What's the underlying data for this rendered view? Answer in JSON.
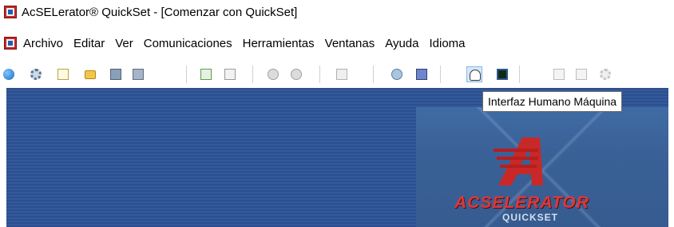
{
  "window": {
    "title": "AcSELerator® QuickSet - [Comenzar con QuickSet]"
  },
  "menubar": {
    "items": [
      "Archivo",
      "Editar",
      "Ver",
      "Comunicaciones",
      "Herramientas",
      "Ventanas",
      "Ayuda",
      "Idioma"
    ]
  },
  "toolbar": {
    "buttons": [
      {
        "icon": "globe-icon"
      },
      {
        "icon": "settings-gear-icon"
      },
      {
        "icon": "new-document-icon"
      },
      {
        "icon": "open-folder-icon"
      },
      {
        "icon": "save-disk-icon"
      },
      {
        "icon": "save-all-disks-icon"
      },
      {
        "icon": "import-icon"
      },
      {
        "icon": "export-icon"
      },
      {
        "icon": "download-icon"
      },
      {
        "icon": "upload-icon"
      },
      {
        "icon": "abc-icon"
      },
      {
        "icon": "connect-icon"
      },
      {
        "icon": "book-icon"
      },
      {
        "icon": "gauge-icon",
        "active": true
      },
      {
        "icon": "terminal-monitor-icon"
      },
      {
        "icon": "edit-document-icon"
      },
      {
        "icon": "list-document-icon"
      },
      {
        "icon": "options-cog-icon"
      }
    ],
    "tooltip": "Interfaz Humano Máquina"
  },
  "logo": {
    "word": "ACSELERATOR",
    "subtitle": "QUICKSET",
    "colors": {
      "red": "#d83a3a",
      "panel_blue": "#3f6ba4",
      "stripe_blue": "#2c4f8f"
    }
  }
}
